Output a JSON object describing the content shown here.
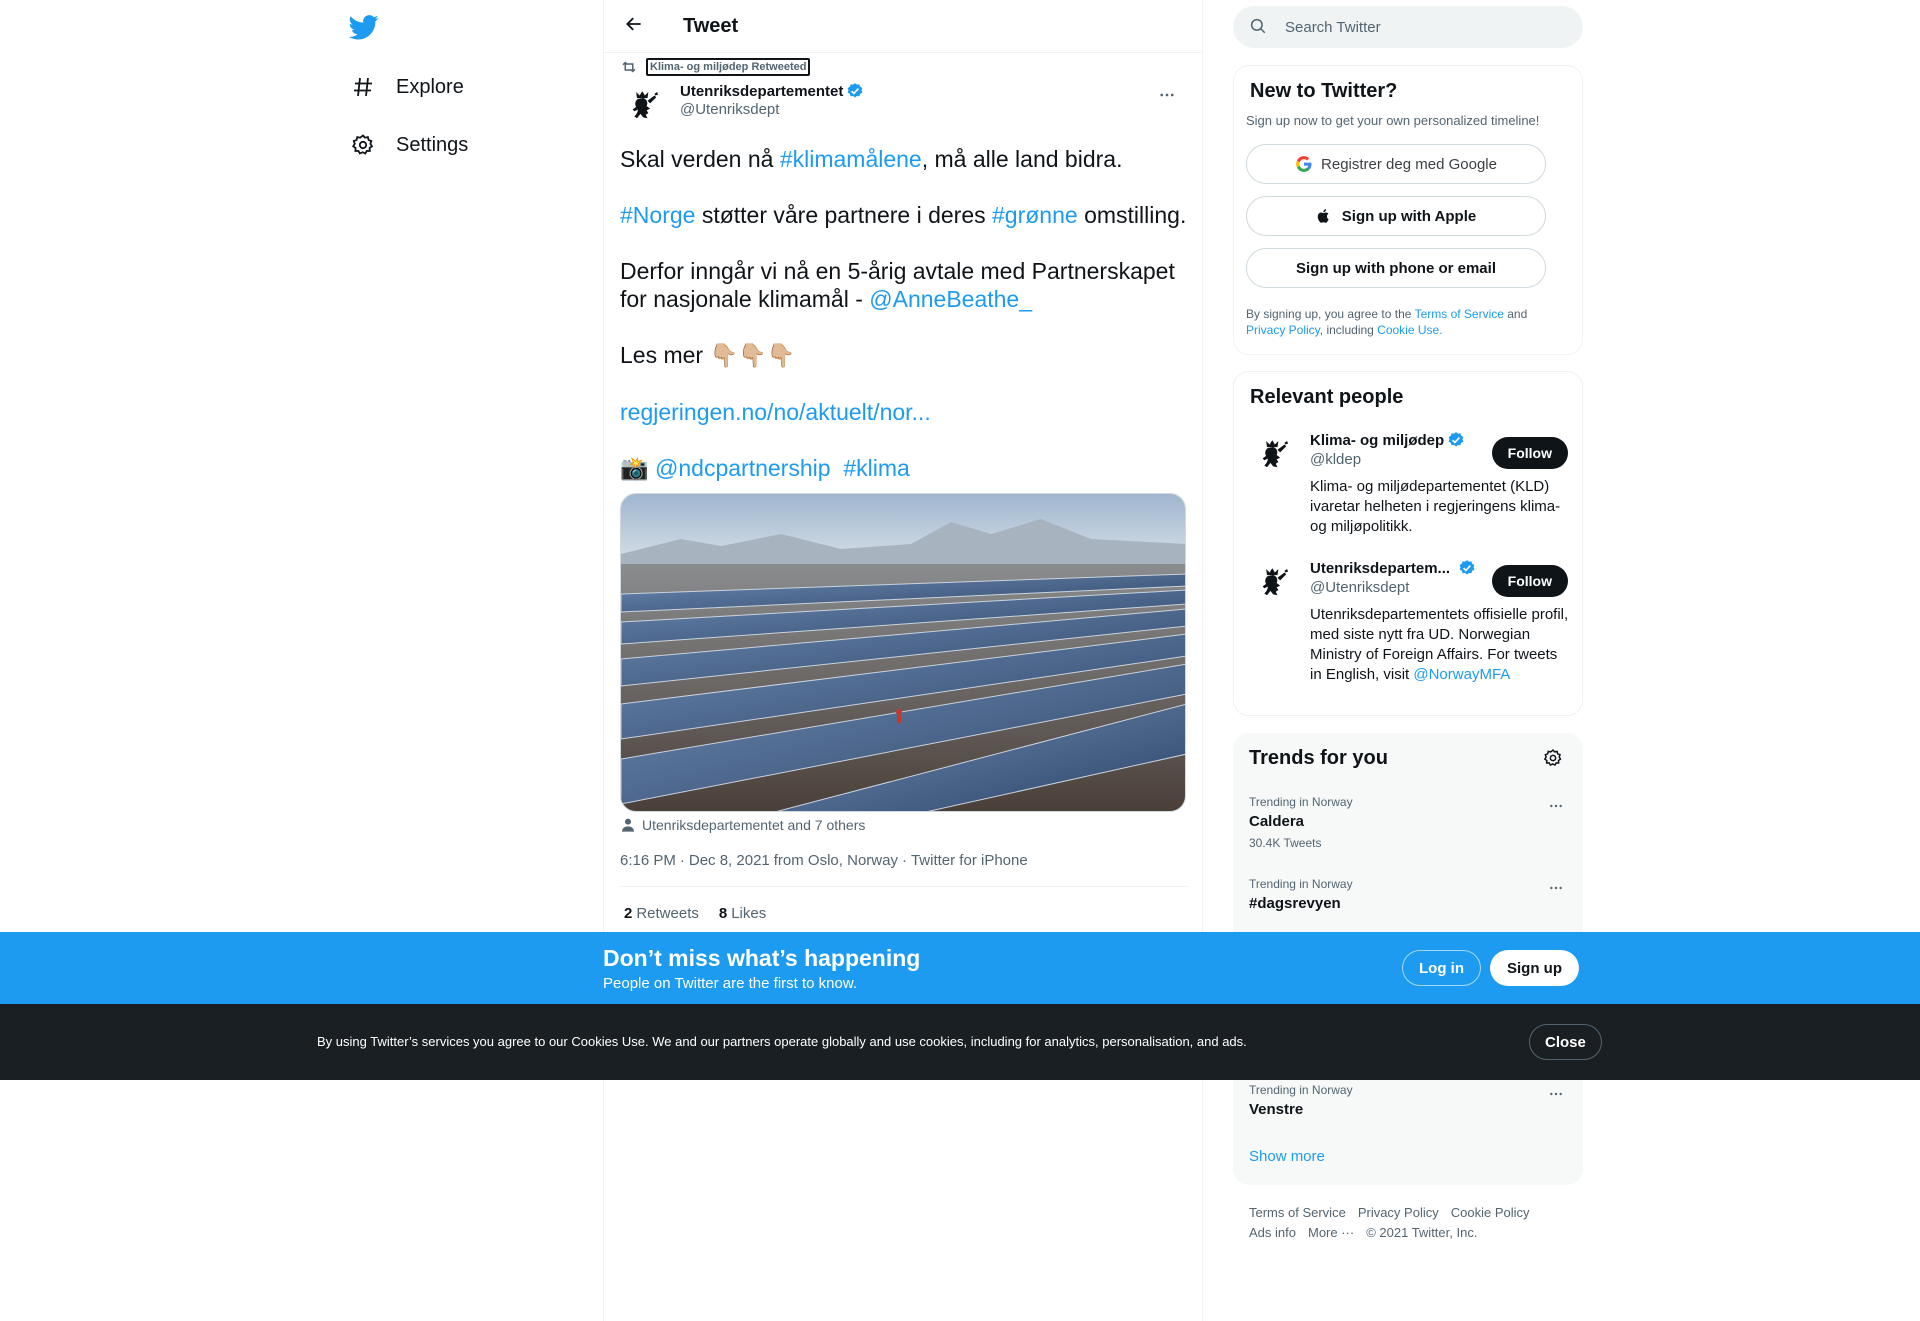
{
  "nav": {
    "items": [
      {
        "label": "Explore",
        "icon": "hashtag-icon"
      },
      {
        "label": "Settings",
        "icon": "gear-icon"
      }
    ]
  },
  "header": {
    "title": "Tweet"
  },
  "tweet": {
    "social_context": "Klima- og miljødep Retweeted",
    "author_name": "Utenriksdepartementet",
    "author_handle": "@Utenriksdept",
    "text": {
      "p1_a": "Skal verden nå ",
      "p1_link": "#klimamålene",
      "p1_b": ", må alle land bidra.",
      "p2_link1": "#Norge",
      "p2_a": " støtter våre partnere i deres ",
      "p2_link2": "#grønne",
      "p2_b": " omstilling.",
      "p3_a": "Derfor inngår vi nå en 5-årig avtale med Partnerskapet for nasjonale klimamål - ",
      "p3_link": "@AnneBeathe_",
      "p4_a": "Les mer ",
      "p4_emoji": "👇🏼👇🏼👇🏼",
      "p5_link": "regjeringen.no/no/aktuelt/nor...",
      "p6_emoji": "📸",
      "p6_link1": "@ndcpartnership",
      "p6_link2": "#klima"
    },
    "tagged": "Utenriksdepartementet and 7 others",
    "time": "6:16 PM",
    "date": "Dec 8, 2021",
    "location": "from Oslo, Norway",
    "source": "Twitter for iPhone",
    "retweets_count": "2",
    "retweets_label": "Retweets",
    "likes_count": "8",
    "likes_label": "Likes"
  },
  "search": {
    "placeholder": "Search Twitter"
  },
  "new_to_twitter": {
    "title": "New to Twitter?",
    "subtitle": "Sign up now to get your own personalized timeline!",
    "google_label": "Registrer deg med Google",
    "apple_label": "Sign up with Apple",
    "phone_label": "Sign up with phone or email",
    "legal_a": "By signing up, you agree to the ",
    "legal_tos": "Terms of Service",
    "legal_b": " and ",
    "legal_privacy": "Privacy Policy",
    "legal_c": ", including ",
    "legal_cookie": "Cookie Use."
  },
  "relevant_people": {
    "title": "Relevant people",
    "people": [
      {
        "name": "Klima- og miljødep",
        "handle": "@kldep",
        "bio": "Klima- og miljødepartementet (KLD) ivaretar helheten i regjeringens klima- og miljøpolitikk.",
        "bio_link": "",
        "follow_label": "Follow"
      },
      {
        "name": "Utenriksdepartem...",
        "handle": "@Utenriksdept",
        "bio": "Utenriksdepartementets offisielle profil, med siste nytt fra UD. Norwegian Ministry of Foreign Affairs. For tweets in English, visit ",
        "bio_link": "@NorwayMFA",
        "follow_label": "Follow"
      }
    ]
  },
  "trends": {
    "title": "Trends for you",
    "items": [
      {
        "context": "Trending in Norway",
        "name": "Caldera",
        "count": "30.4K Tweets"
      },
      {
        "context": "Trending in Norway",
        "name": "#dagsrevyen",
        "count": ""
      },
      {
        "context": "Trending in Norway",
        "name": "Venstre",
        "count": ""
      }
    ],
    "show_more": "Show more"
  },
  "footer": {
    "links": [
      "Terms of Service",
      "Privacy Policy",
      "Cookie Policy",
      "Ads info",
      "More ···",
      "© 2021 Twitter, Inc."
    ]
  },
  "banner": {
    "title": "Don’t miss what’s happening",
    "subtitle": "People on Twitter are the first to know.",
    "login_label": "Log in",
    "signup_label": "Sign up"
  },
  "cookie": {
    "text": "By using Twitter’s services you agree to our Cookies Use. We and our partners operate globally and use cookies, including for analytics, personalisation, and ads.",
    "close_label": "Close"
  },
  "colors": {
    "accent": "#1d9bf0",
    "text": "#0f1419",
    "muted": "#536471",
    "cookie_bg": "#1a1f23"
  }
}
